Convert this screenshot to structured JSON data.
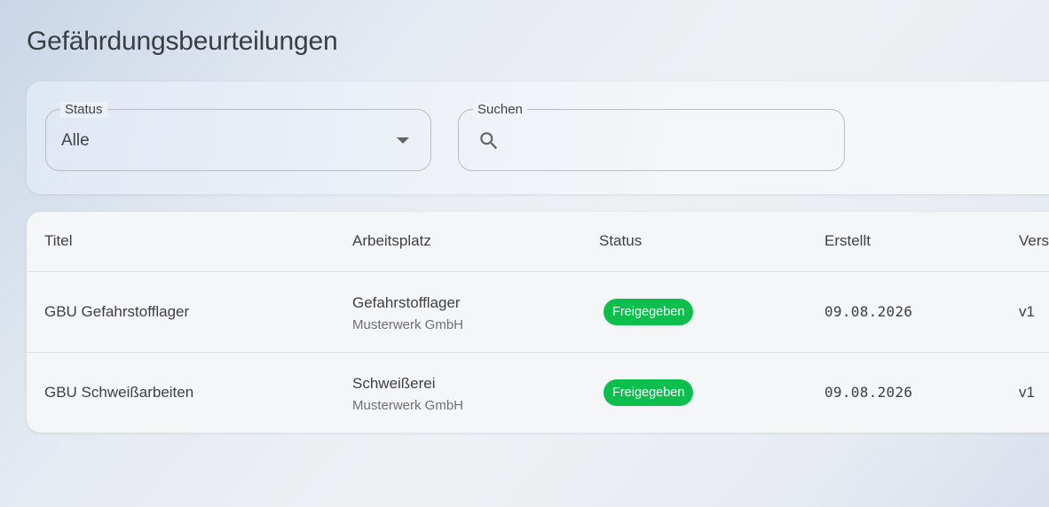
{
  "page": {
    "title": "Gefährdungsbeurteilungen"
  },
  "filters": {
    "status": {
      "label": "Status",
      "value": "Alle",
      "icon": "chevron-down-icon"
    },
    "search": {
      "label": "Suchen",
      "value": "",
      "placeholder": "",
      "icon": "search-icon"
    }
  },
  "table": {
    "columns": [
      "Titel",
      "Arbeitsplatz",
      "Status",
      "Erstellt",
      "Vers"
    ],
    "rows": [
      {
        "title": "GBU Gefahrstofflager",
        "workplace": "Gefahrstofflager",
        "company": "Musterwerk GmbH",
        "status": "Freigegeben",
        "created": "09.08.2026",
        "version": "v1"
      },
      {
        "title": "GBU Schweißarbeiten",
        "workplace": "Schweißerei",
        "company": "Musterwerk GmbH",
        "status": "Freigegeben",
        "created": "09.08.2026",
        "version": "v1"
      }
    ]
  },
  "colors": {
    "status_approved": "#0cbf4c"
  }
}
